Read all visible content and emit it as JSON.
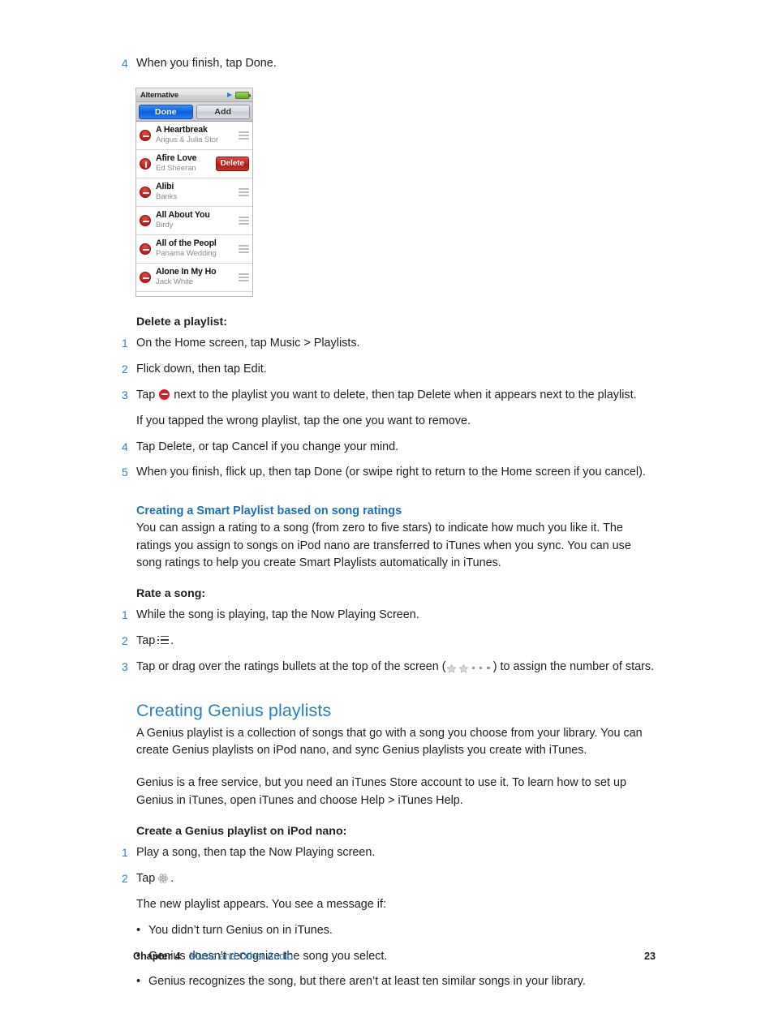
{
  "intro_step": {
    "num": "4",
    "text": "When you finish, tap Done."
  },
  "device": {
    "title": "Alternative",
    "play_icon": "play-triangle-icon",
    "battery_icon": "battery-icon",
    "buttons": {
      "done": "Done",
      "add": "Add"
    },
    "rows": [
      {
        "song": "A Heartbreak",
        "artist": "Angus & Julia Stor",
        "delete_icon": "minus-circle-icon",
        "handle": "reorder-handle-icon",
        "action": ""
      },
      {
        "song": "Afire Love",
        "artist": "Ed Sheeran",
        "delete_icon": "minus-circle-rotated-icon",
        "handle": "",
        "action": "Delete"
      },
      {
        "song": "Alibi",
        "artist": "Banks",
        "delete_icon": "minus-circle-icon",
        "handle": "reorder-handle-icon",
        "action": ""
      },
      {
        "song": "All About You",
        "artist": "Birdy",
        "delete_icon": "minus-circle-icon",
        "handle": "reorder-handle-icon",
        "action": ""
      },
      {
        "song": "All of the Peopl",
        "artist": "Panama Wedding",
        "delete_icon": "minus-circle-icon",
        "handle": "reorder-handle-icon",
        "action": ""
      },
      {
        "song": "Alone In My Ho",
        "artist": "Jack White",
        "delete_icon": "minus-circle-icon",
        "handle": "reorder-handle-icon",
        "action": ""
      }
    ]
  },
  "delete_playlist": {
    "heading": "Delete a playlist:",
    "steps": [
      {
        "num": "1",
        "text": "On the Home screen, tap Music > Playlists."
      },
      {
        "num": "2",
        "text": "Flick down, then tap Edit."
      }
    ],
    "step3": {
      "num": "3",
      "text_before": "Tap",
      "icon": "minus-circle-icon",
      "text_after": "next to the playlist you want to delete, then tap Delete when it appears next to the playlist."
    },
    "note": "If you tapped the wrong playlist, tap the one you want to remove.",
    "steps_after": [
      {
        "num": "4",
        "text": "Tap Delete, or tap Cancel if you change your mind."
      },
      {
        "num": "5",
        "text": "When you finish, flick up, then tap Done (or swipe right to return to the Home screen if you cancel)."
      }
    ]
  },
  "smart_playlist": {
    "heading": "Creating a Smart Playlist based on song ratings",
    "body": "You can assign a rating to a song (from zero to five stars) to indicate how much you like it. The ratings you assign to songs on iPod nano are transferred to iTunes when you sync. You can use song ratings to help you create Smart Playlists automatically in iTunes."
  },
  "rate_song": {
    "heading": "Rate a song:",
    "step1": {
      "num": "1",
      "text": "While the song is playing, tap the Now Playing Screen."
    },
    "step2": {
      "num": "2",
      "text_before": "Tap",
      "icon": "list-menu-icon",
      "text_after": "."
    },
    "step3": {
      "num": "3",
      "text_before": "Tap or drag over the ratings bullets at the top of the screen (",
      "icon": "rating-stars-icon",
      "stars": 2,
      "dots": 3,
      "text_after": ") to assign the number of stars."
    }
  },
  "genius": {
    "heading": "Creating Genius playlists",
    "para1": "A Genius playlist is a collection of songs that go with a song you choose from your library. You can create Genius playlists on iPod nano, and sync Genius playlists you create with iTunes.",
    "para2": "Genius is a free service, but you need an iTunes Store account to use it. To learn how to set up Genius in iTunes, open iTunes and choose Help > iTunes Help.",
    "subheading": "Create a Genius playlist on iPod nano:",
    "step1": {
      "num": "1",
      "text": "Play a song, then tap the Now Playing screen."
    },
    "step2": {
      "num": "2",
      "text_before": "Tap",
      "icon": "genius-atom-icon",
      "text_after": "."
    },
    "note": "The new playlist appears. You see a message if:",
    "bullets": [
      "You didn’t turn Genius on in iTunes.",
      "Genius doesn’t recognize the song you select.",
      "Genius recognizes the song, but there aren’t at least ten similar songs in your library."
    ]
  },
  "footer": {
    "chapter_label": "Chapter",
    "chapter_number": "4",
    "chapter_title": "Music and Other Audio",
    "page_number": "23"
  },
  "colors": {
    "accent_blue": "#2b80c4",
    "heading_blue": "#1d6fb8",
    "step_number_blue": "#2b7fd4",
    "delete_red": "#c32622",
    "body_text": "#231f20"
  }
}
